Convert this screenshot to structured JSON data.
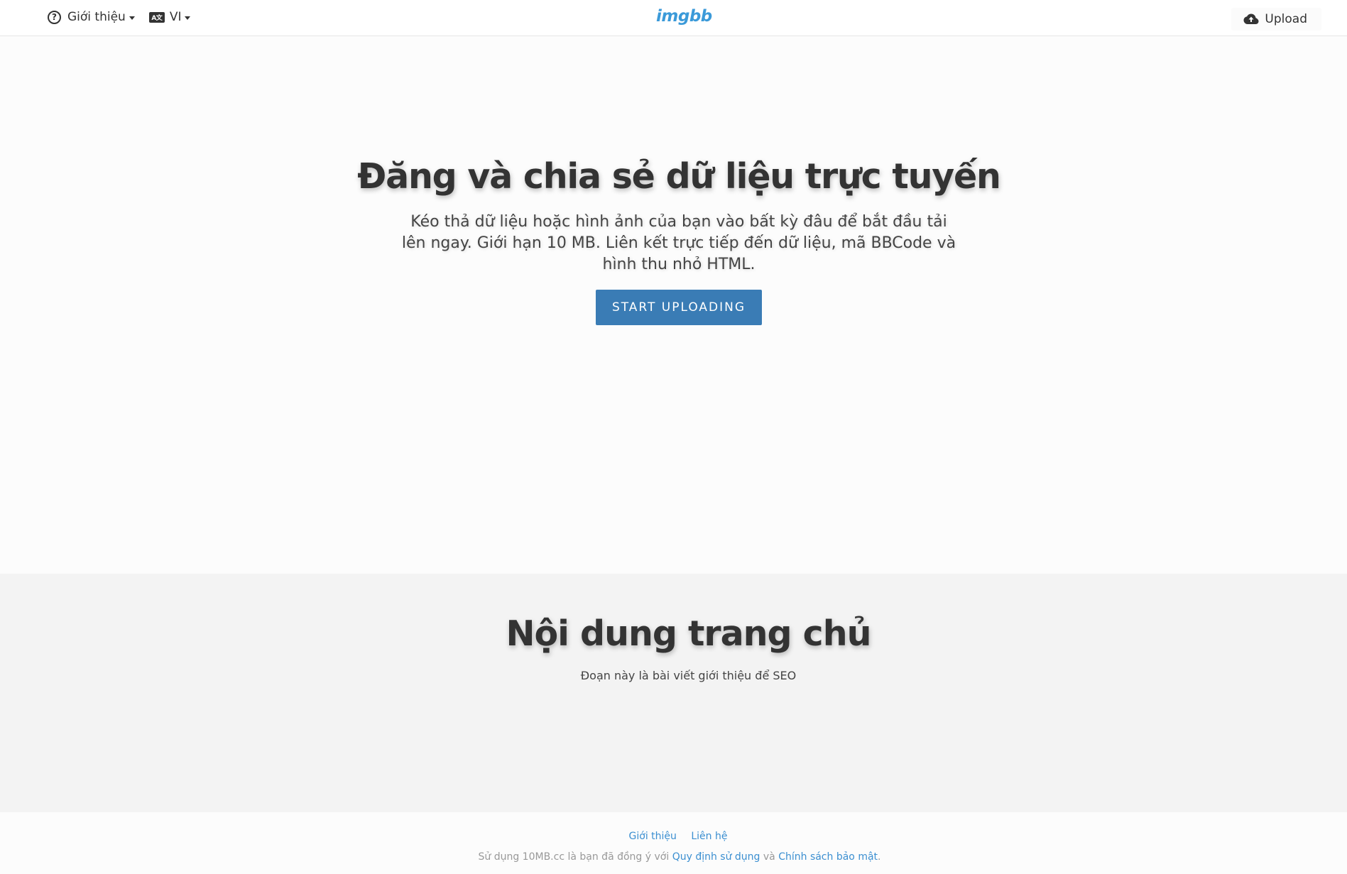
{
  "header": {
    "about_label": "Giới thiệu",
    "language_code": "VI",
    "language_icon_text": "A文",
    "logo": "imgbb",
    "upload_label": "Upload"
  },
  "hero": {
    "title": "Đăng và chia sẻ dữ liệu trực tuyến",
    "description": "Kéo thả dữ liệu hoặc hình ảnh của bạn vào bất kỳ đâu để bắt đầu tải lên ngay. Giới hạn 10 MB. Liên kết trực tiếp đến dữ liệu, mã BBCode và hình thu nhỏ HTML.",
    "button_label": "START UPLOADING"
  },
  "content": {
    "title": "Nội dung trang chủ",
    "description": "Đoạn này là bài viết giới thiệu để SEO"
  },
  "footer": {
    "links": [
      "Giới thiệu",
      "Liên hệ"
    ],
    "legal_prefix": "Sử dụng 10MB.cc là bạn đã đồng ý với ",
    "terms_link": "Quy định sử dụng",
    "legal_and": " và ",
    "privacy_link": "Chính sách bảo mật",
    "legal_suffix": "."
  },
  "colors": {
    "accent": "#3a7cb5",
    "logo": "#3b9ad9",
    "link": "#3b8fd1",
    "section_bg": "#f3f3f3"
  },
  "icons": [
    "help-circle-icon",
    "language-icon",
    "caret-down-icon",
    "cloud-upload-icon"
  ]
}
